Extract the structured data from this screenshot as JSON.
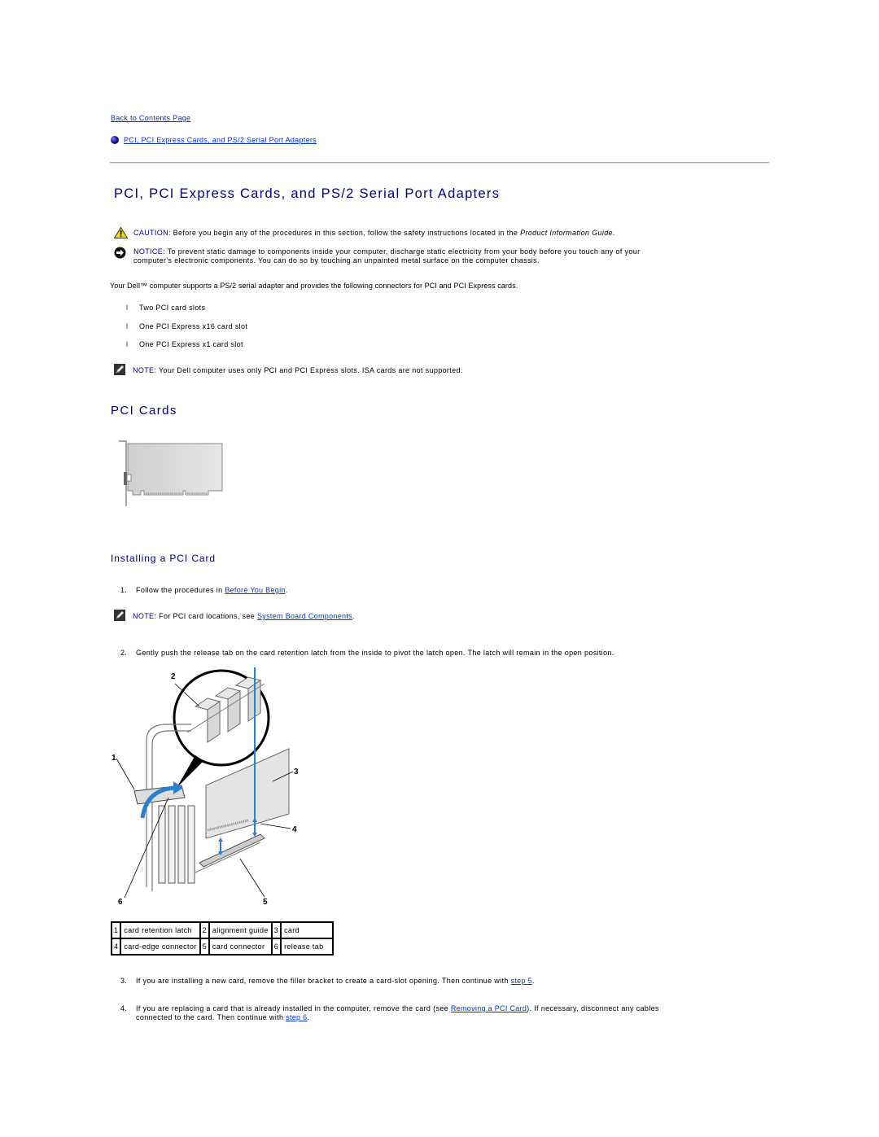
{
  "nav": {
    "back_link": "Back to Contents Page",
    "toc_link": "PCI, PCI Express Cards, and PS/2 Serial Port Adapters"
  },
  "page_title": "PCI, PCI Express Cards, and PS/2 Serial Port Adapters",
  "caution": {
    "icon": "warning-triangle-icon",
    "label": "CAUTION:",
    "text": " Before you begin any of the procedures in this section, follow the safety instructions located in the ",
    "italic": "Product Information Guide",
    "end": "."
  },
  "notice": {
    "icon": "notice-arrow-icon",
    "label": "NOTICE:",
    "line1": " To prevent static damage to components inside your computer, discharge static electricity from your body before you touch any of your",
    "line2": "computer's electronic components. You can do so by touching an unpainted metal surface on the computer chassis."
  },
  "intro": "Your Dell™ computer supports a PS/2 serial adapter and provides the following connectors for PCI and PCI Express cards.",
  "connectors": [
    "Two PCI card slots",
    "One PCI Express x16 card slot",
    "One PCI Express x1 card slot"
  ],
  "list_marker": "l",
  "note1": {
    "icon": "note-pencil-icon",
    "label": "NOTE:",
    "text": " Your Dell computer uses only PCI and PCI Express slots. ISA cards are not supported."
  },
  "section_pci_cards": "PCI Cards",
  "subsection_install": "Installing a PCI Card",
  "steps": {
    "s1_num": "1.",
    "s1_text": "Follow the procedures in ",
    "s1_link": "Before You Begin",
    "s1_end": ".",
    "note2_label": "NOTE:",
    "note2_text": " For PCI card locations, see ",
    "note2_link": "System Board Components",
    "note2_end": ".",
    "s2_num": "2.",
    "s2_text": "Gently push the release tab on the card retention latch from the inside to pivot the latch open. The latch will remain in the open position.",
    "s3_num": "3.",
    "s3_text": "If you are installing a new card, remove the filler bracket to create a card-slot opening. Then continue with ",
    "s3_link": "step 5",
    "s3_end": ".",
    "s4_num": "4.",
    "s4_text1": "If you are replacing a card that is already installed in the computer, remove the card (see ",
    "s4_link1": "Removing a PCI Card",
    "s4_text2": "). If necessary, disconnect any cables",
    "s4_text3": "connected to the card. Then continue with ",
    "s4_link2": "step 6",
    "s4_end": "."
  },
  "figure_callouts": [
    "1",
    "2",
    "3",
    "4",
    "5",
    "6"
  ],
  "legend": [
    [
      {
        "n": "1",
        "label": "card retention latch"
      },
      {
        "n": "2",
        "label": "alignment guide"
      },
      {
        "n": "3",
        "label": "card"
      }
    ],
    [
      {
        "n": "4",
        "label": "card-edge connector"
      },
      {
        "n": "5",
        "label": "card connector"
      },
      {
        "n": "6",
        "label": "release tab"
      }
    ]
  ]
}
